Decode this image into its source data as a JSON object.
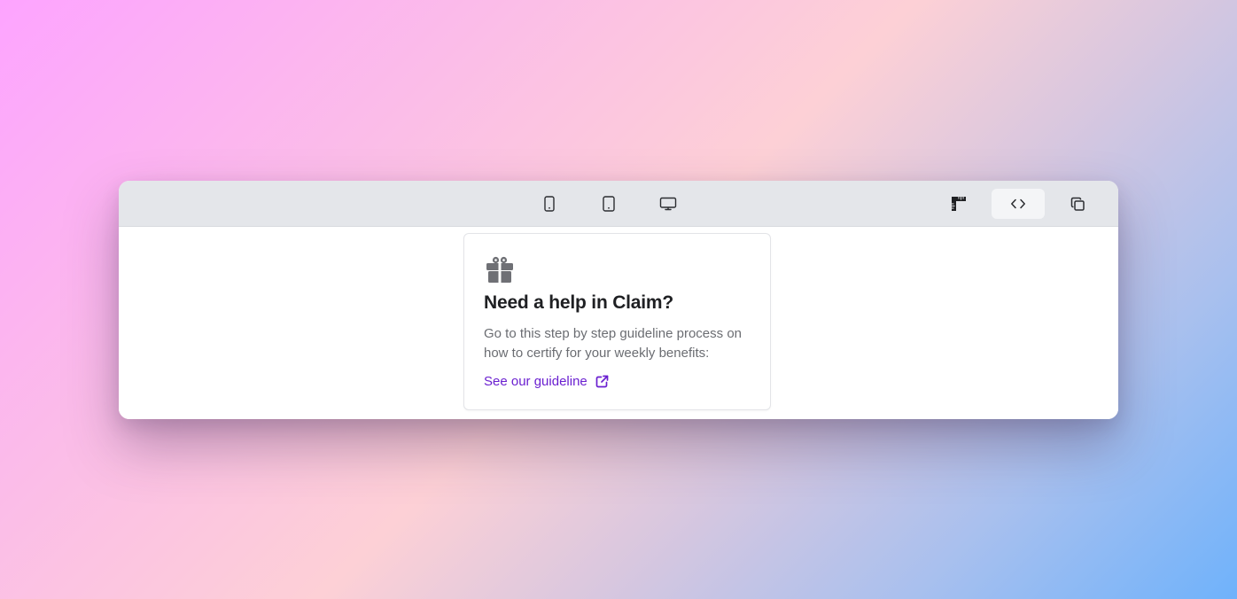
{
  "toolbar": {
    "device_buttons": [
      {
        "name": "mobile",
        "icon": "mobile-icon"
      },
      {
        "name": "tablet",
        "icon": "tablet-icon"
      },
      {
        "name": "desktop",
        "icon": "desktop-icon"
      }
    ],
    "tool_buttons": [
      {
        "name": "ruler",
        "icon": "ruler-icon"
      },
      {
        "name": "code",
        "icon": "code-icon",
        "active": true
      },
      {
        "name": "copy",
        "icon": "copy-icon"
      }
    ]
  },
  "card": {
    "icon": "gift-icon",
    "title": "Need a help in Claim?",
    "description": "Go to this step by step guideline process on how to certify for your weekly benefits:",
    "link_label": "See our guideline",
    "link_icon": "external-link-icon"
  },
  "colors": {
    "link": "#6a1fd0",
    "title": "#1f2023",
    "description": "#6b6d72",
    "toolbar_bg": "#e4e6ea",
    "icon_gray": "#6f7075"
  }
}
